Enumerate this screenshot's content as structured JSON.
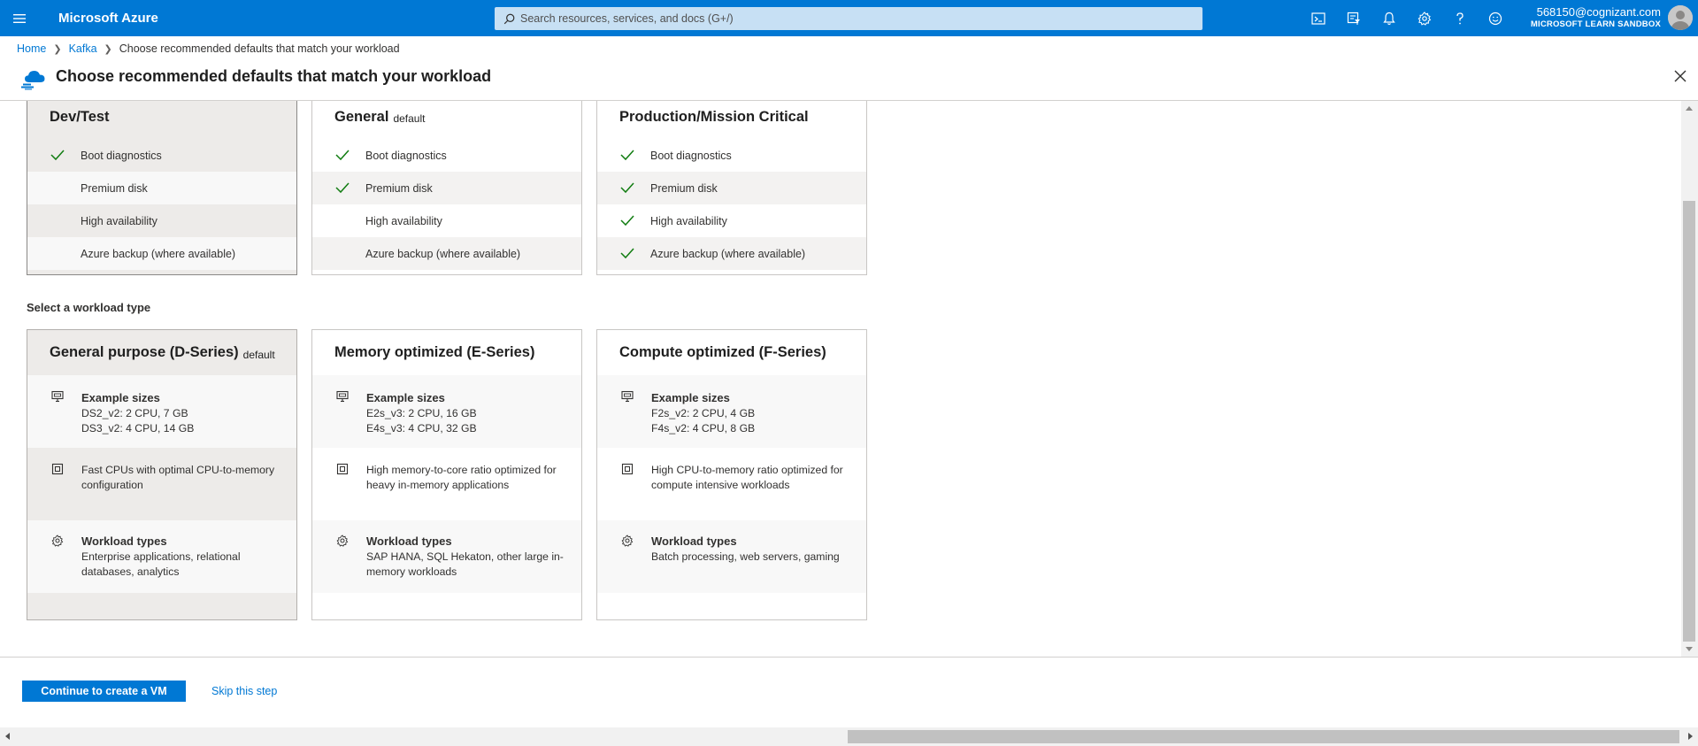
{
  "topbar": {
    "brand": "Microsoft Azure",
    "search_placeholder": "Search resources, services, and docs (G+/)",
    "account_email": "568150@cognizant.com",
    "account_tenant": "MICROSOFT LEARN SANDBOX",
    "icons": [
      "cloud-shell-icon",
      "directory-filter-icon",
      "notifications-icon",
      "settings-icon",
      "help-icon",
      "feedback-icon"
    ]
  },
  "breadcrumb": {
    "home": "Home",
    "kafka": "Kafka",
    "current": "Choose recommended defaults that match your workload"
  },
  "page": {
    "title": "Choose recommended defaults that match your workload"
  },
  "environments": [
    {
      "title": "Dev/Test",
      "tag": "",
      "selected": true,
      "features": [
        {
          "label": "Boot diagnostics",
          "checked": true
        },
        {
          "label": "Premium disk",
          "checked": false
        },
        {
          "label": "High availability",
          "checked": false
        },
        {
          "label": "Azure backup (where available)",
          "checked": false
        }
      ]
    },
    {
      "title": "General",
      "tag": "default",
      "selected": false,
      "features": [
        {
          "label": "Boot diagnostics",
          "checked": true
        },
        {
          "label": "Premium disk",
          "checked": true
        },
        {
          "label": "High availability",
          "checked": false
        },
        {
          "label": "Azure backup (where available)",
          "checked": false
        }
      ]
    },
    {
      "title": "Production/Mission Critical",
      "tag": "",
      "selected": false,
      "features": [
        {
          "label": "Boot diagnostics",
          "checked": true
        },
        {
          "label": "Premium disk",
          "checked": true
        },
        {
          "label": "High availability",
          "checked": true
        },
        {
          "label": "Azure backup (where available)",
          "checked": true
        }
      ]
    }
  ],
  "workload_section_label": "Select a workload type",
  "workloads": [
    {
      "title": "General purpose (D-Series)",
      "tag": "default",
      "selected": true,
      "sizes_label": "Example sizes",
      "sizes": [
        "DS2_v2: 2 CPU, 7 GB",
        "DS3_v2: 4 CPU, 14 GB"
      ],
      "description": "Fast CPUs with optimal CPU-to-memory configuration",
      "types_label": "Workload types",
      "types": "Enterprise applications, relational databases, analytics"
    },
    {
      "title": "Memory optimized (E-Series)",
      "tag": "",
      "selected": false,
      "sizes_label": "Example sizes",
      "sizes": [
        "E2s_v3: 2 CPU, 16 GB",
        "E4s_v3: 4 CPU, 32 GB"
      ],
      "description": "High memory-to-core ratio optimized for heavy in-memory applications",
      "types_label": "Workload types",
      "types": "SAP HANA, SQL Hekaton, other large in-memory workloads"
    },
    {
      "title": "Compute optimized (F-Series)",
      "tag": "",
      "selected": false,
      "sizes_label": "Example sizes",
      "sizes": [
        "F2s_v2: 2 CPU, 4 GB",
        "F4s_v2: 4 CPU, 8 GB"
      ],
      "description": "High CPU-to-memory ratio optimized for compute intensive workloads",
      "types_label": "Workload types",
      "types": "Batch processing, web servers, gaming"
    }
  ],
  "footer": {
    "continue_label": "Continue to create a VM",
    "skip_label": "Skip this step"
  },
  "colors": {
    "accent": "#0078d4",
    "check": "#107c10"
  }
}
